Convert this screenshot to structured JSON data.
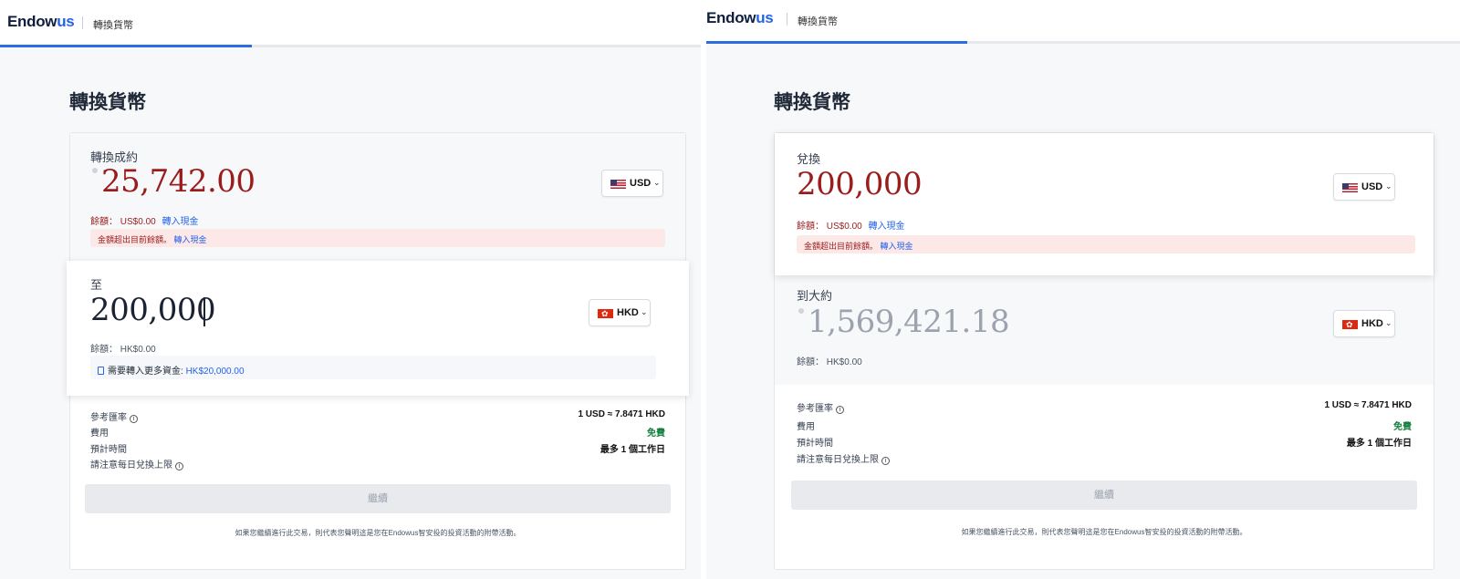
{
  "brand": {
    "logo_main": "Endow",
    "logo_accent": "us"
  },
  "colors": {
    "amount_red": "#9b1c1c",
    "link_blue": "#2563eb",
    "progress_blue": "#2b6de0",
    "free_green": "#15803d",
    "error_bg": "#fde8e8"
  },
  "left": {
    "nav_title": "轉換貨幣",
    "page_title": "轉換貨幣",
    "from": {
      "label": "轉換成約",
      "amount": "25,742.00",
      "currency": "USD",
      "balance_label": "餘額：",
      "balance_value": "US$0.00",
      "transfer_link": "轉入現金",
      "error_text": "金額超出目前餘額。",
      "error_link": "轉入現金"
    },
    "to": {
      "label": "至",
      "amount": "200,000",
      "currency": "HKD",
      "balance_label": "餘額：",
      "balance_value": "HK$0.00",
      "info_text": "需要轉入更多資金:",
      "info_amount": "HK$20,000.00"
    },
    "summary": {
      "rate_label": "參考匯率",
      "rate_value": "1 USD ≈ 7.8471 HKD",
      "fee_label": "費用",
      "fee_value": "免費",
      "time_label": "預計時間",
      "time_value": "最多 1 個工作日",
      "limit_label": "請注意每日兌換上限"
    },
    "continue_label": "繼續",
    "disclaimer": "如果您繼續進行此交易，則代表您聲明這是您在Endowus智安投的投資活動的附帶活動。"
  },
  "right": {
    "nav_title": "轉換貨幣",
    "page_title": "轉換貨幣",
    "from": {
      "label": "兌換",
      "amount": "200,000",
      "currency": "USD",
      "balance_label": "餘額：",
      "balance_value": "US$0.00",
      "transfer_link": "轉入現金",
      "error_text": "金額超出目前餘額。",
      "error_link": "轉入現金"
    },
    "to": {
      "label": "到大約",
      "amount": "1,569,421.18",
      "currency": "HKD",
      "balance_label": "餘額：",
      "balance_value": "HK$0.00"
    },
    "summary": {
      "rate_label": "參考匯率",
      "rate_value": "1 USD ≈ 7.8471 HKD",
      "fee_label": "費用",
      "fee_value": "免費",
      "time_label": "預計時間",
      "time_value": "最多 1 個工作日",
      "limit_label": "請注意每日兌換上限"
    },
    "continue_label": "繼續",
    "disclaimer": "如果您繼續進行此交易，則代表您聲明這是您在Endowus智安投的投資活動的附帶活動。"
  }
}
